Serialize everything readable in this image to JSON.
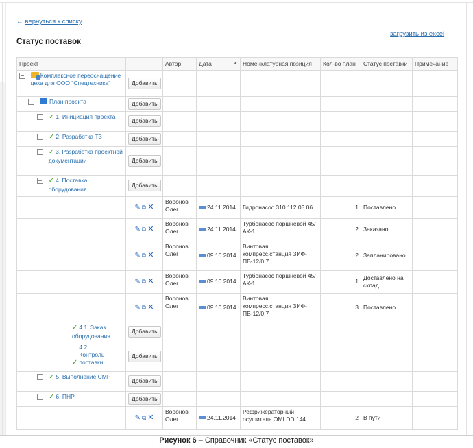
{
  "nav": {
    "back_label": "вернуться к списку",
    "back_arrow": "←",
    "excel_label": "загрузить из excel"
  },
  "page_title": "Статус поставок",
  "columns": [
    "Проект",
    "",
    "Автор",
    "Дата",
    "Номенклатурная позиция",
    "Кол-во план",
    "Статус поставки",
    "Примечание"
  ],
  "sort_indicator": "▲",
  "add_label": "Добавить",
  "toggle_expanded": "−",
  "toggle_collapsed": "+",
  "tree": {
    "root": "Комплексное переоснащение цеха для ООО \"Спецтехника\"",
    "plan": "План проекта",
    "stage1": "1. Инициация проекта",
    "stage2": "2. Разработка ТЗ",
    "stage3": "3. Разработка проектной документации",
    "stage4": "4. Поставка оборудования",
    "stage41": "4.1. Заказ оборудования",
    "stage42": "4.2. Контроль поставки",
    "stage5": "5. Выполнение СМР",
    "stage6": "6. ПНР"
  },
  "deliveries": [
    {
      "author": "Воронов Олег",
      "date": "24.11.2014",
      "item": "Гидронасос 310.112.03.06",
      "qty": "1",
      "status": "Поставлено",
      "note": ""
    },
    {
      "author": "Воронов Олег",
      "date": "24.11.2014",
      "item": "Турбонасос поршневой 45/АК-1",
      "qty": "2",
      "status": "Заказано",
      "note": ""
    },
    {
      "author": "Воронов Олег",
      "date": "09.10.2014",
      "item": "Винтовая компресс.станция ЗИФ-ПВ-12/0,7",
      "qty": "2",
      "status": "Запланировано",
      "note": ""
    },
    {
      "author": "Воронов Олег",
      "date": "09.10.2014",
      "item": "Турбонасос поршневой 45/АК-1",
      "qty": "1",
      "status": "Доставлено на склад",
      "note": ""
    },
    {
      "author": "Воронов Олег",
      "date": "09.10.2014",
      "item": "Винтовая компресс.станция ЗИФ-ПВ-12/0,7",
      "qty": "3",
      "status": "Поставлено",
      "note": ""
    }
  ],
  "delivery_pnr": {
    "author": "Воронов Олег",
    "date": "24.11.2014",
    "item": "Рефрижераторный осушитель OMI DD 144",
    "qty": "2",
    "status": "В пути",
    "note": ""
  },
  "icons": {
    "edit": "✎",
    "copy": "⧉",
    "delete": "✕",
    "check": "✓"
  },
  "caption": {
    "prefix": "Рисунок 6",
    "rest": " – Справочник «Статус поставок»"
  }
}
